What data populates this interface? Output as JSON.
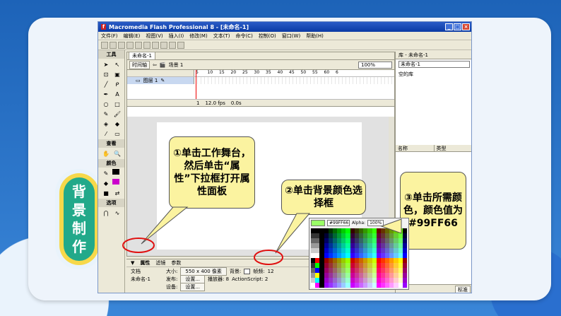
{
  "badge": {
    "chars": [
      "背",
      "景",
      "制",
      "作"
    ]
  },
  "window": {
    "title": "Macromedia Flash Professional 8 - [未命名-1]"
  },
  "menubar": [
    "文件(F)",
    "编辑(E)",
    "视图(V)",
    "插入(I)",
    "修改(M)",
    "文本(T)",
    "命令(C)",
    "控制(O)",
    "窗口(W)",
    "帮助(H)"
  ],
  "tools": {
    "title": "工具",
    "view_label": "查看",
    "color_label": "颜色",
    "options_label": "选项"
  },
  "document": {
    "tab": "未命名-1",
    "timeline_button": "时间轴",
    "scene": "场景 1",
    "zoom": "100%",
    "layer_name": "图层 1",
    "frame_numbers": [
      "5",
      "10",
      "15",
      "20",
      "25",
      "30",
      "35",
      "40",
      "45",
      "50",
      "55",
      "60",
      "6"
    ],
    "frame_current": "1",
    "fps": "12.0 fps",
    "time": "0.0s"
  },
  "properties": {
    "tabs": [
      "属性",
      "滤镜",
      "参数"
    ],
    "doc_label": "文档",
    "doc_name": "未命名-1",
    "size_label": "大小:",
    "size_value": "550 x 400 像素",
    "bg_label": "背景:",
    "fps_label": "帧频:",
    "fps_value": "12",
    "publish_label": "发布:",
    "settings_label": "设置...",
    "player_label": "播放器: 8",
    "actionscript_label": "ActionScript: 2",
    "device_label": "设备:"
  },
  "right_panel": {
    "library_header": "库 - 未命名-1",
    "select_value": "未命名-1",
    "empty_lib": "空的库",
    "col_name": "名称",
    "col_type": "类型",
    "footer_btn": "标准"
  },
  "picker": {
    "hex": "#99FF66",
    "alpha_label": "Alpha:",
    "alpha_value": "100%",
    "swatch_color": "#99FF66"
  },
  "callouts": {
    "c1": "①单击工作舞台，然后单击“属性”下拉框打开属性面板",
    "c2": "②单击背景颜色选择框",
    "c3": "③单击所需颜色，颜色值为#99FF66"
  }
}
